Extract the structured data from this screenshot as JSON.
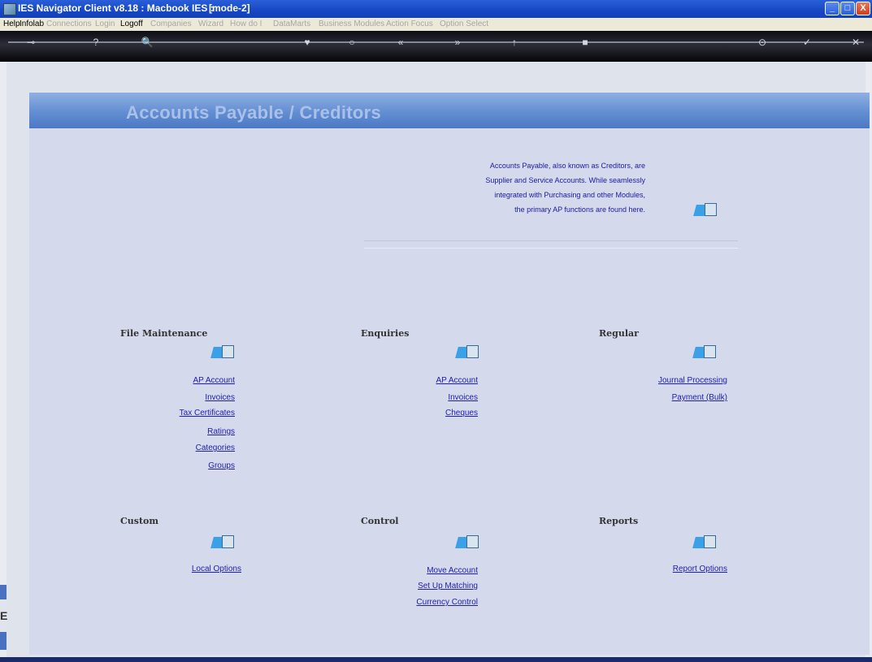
{
  "window": {
    "title": "IES Navigator Client v8.18 : Macbook IES :",
    "mode": "[mode-2]",
    "buttons": {
      "minimize": "_",
      "maximize": "□",
      "close": "X"
    }
  },
  "menu": [
    {
      "label": "Help",
      "enabled": true
    },
    {
      "label": "Infolab",
      "enabled": true
    },
    {
      "label": "Connections",
      "enabled": false
    },
    {
      "label": "Login",
      "enabled": false
    },
    {
      "label": "Logoff",
      "enabled": true
    },
    {
      "label": "Companies",
      "enabled": false
    },
    {
      "label": "Wizard",
      "enabled": false
    },
    {
      "label": "How do I",
      "enabled": false
    },
    {
      "label": "DataMarts",
      "enabled": false
    },
    {
      "label": "Business Modules",
      "enabled": false
    },
    {
      "label": "Action Focus",
      "enabled": false
    },
    {
      "label": "Option Select",
      "enabled": false
    }
  ],
  "toolbar": {
    "icons": [
      "key-icon",
      "help-icon",
      "search-icon",
      "heart-icon",
      "circle-icon",
      "back-icon",
      "forward-icon",
      "up-icon",
      "stop-icon",
      "print-icon",
      "check-icon",
      "close-icon"
    ],
    "glyphs": [
      "⊸",
      "?",
      "🔍",
      "♥",
      "○",
      "«",
      "»",
      "↑",
      "■",
      "⊙",
      "✓",
      "✕"
    ]
  },
  "page": {
    "title": "Accounts Payable / Creditors",
    "intro": [
      "Accounts Payable, also known as Creditors, are",
      "Supplier and Service Accounts. While seamlessly",
      "integrated with Purchasing and other Modules,",
      "the primary AP functions are found here."
    ]
  },
  "sections": {
    "file_maintenance": {
      "title": "File Maintenance",
      "links": [
        "AP Account",
        "Invoices",
        "Tax Certificates",
        "Ratings",
        "Categories",
        "Groups"
      ]
    },
    "enquiries": {
      "title": "Enquiries",
      "links": [
        "AP Account",
        "Invoices",
        "Cheques"
      ]
    },
    "regular": {
      "title": "Regular",
      "links": [
        "Journal Processing",
        "Payment (Bulk)"
      ]
    },
    "custom": {
      "title": "Custom",
      "links": [
        "Local Options"
      ]
    },
    "control": {
      "title": "Control",
      "links": [
        "Move Account",
        "Set Up Matching",
        "Currency Control"
      ]
    },
    "reports": {
      "title": "Reports",
      "links": [
        "Report Options"
      ]
    }
  },
  "sidebar": {
    "letter": "E"
  }
}
